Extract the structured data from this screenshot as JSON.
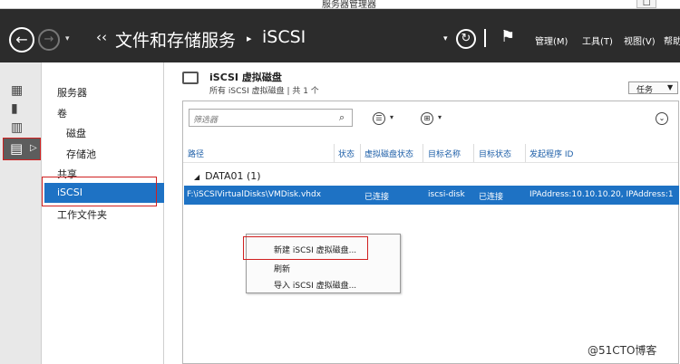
{
  "window": {
    "title": "服务器管理器",
    "controls": [
      "—",
      "□",
      "✕"
    ]
  },
  "header": {
    "back_glyph": "←",
    "forward_glyph": "→",
    "history_glyph": "▾",
    "crumb_glyph": "‹‹",
    "breadcrumb": [
      "文件和存储服务",
      "iSCSI"
    ],
    "separator": "▸",
    "dropdown_glyph": "▾",
    "refresh_glyph": "↻",
    "flag_glyph": "⚑",
    "menus": [
      "管理(M)",
      "工具(T)",
      "视图(V)",
      "帮助"
    ]
  },
  "rail": {
    "icons": [
      "dashboard-icon",
      "local-server-icon",
      "all-servers-icon",
      "file-storage-icon"
    ],
    "glyphs": [
      "▦",
      "▮",
      "▥",
      "▤"
    ],
    "expand_glyph": "▷"
  },
  "nav": {
    "items": [
      {
        "label": "服务器",
        "indent": false
      },
      {
        "label": "卷",
        "indent": false
      },
      {
        "label": "磁盘",
        "indent": true
      },
      {
        "label": "存储池",
        "indent": true
      },
      {
        "label": "共享",
        "indent": false
      },
      {
        "label": "iSCSI",
        "indent": false
      },
      {
        "label": "工作文件夹",
        "indent": false
      }
    ],
    "selected": "iSCSI"
  },
  "section": {
    "title": "iSCSI 虚拟磁盘",
    "subtitle": "所有 iSCSI 虚拟磁盘 | 共 1 个",
    "tasks_label": "任务",
    "tasks_glyph": "▼"
  },
  "toolbar": {
    "filter_placeholder": "筛选器",
    "search_glyph": "⌕",
    "list_glyph": "☰",
    "save_glyph": "⊞",
    "caret_glyph": "▾",
    "expand_glyph": "⌄"
  },
  "table": {
    "columns": [
      "路径",
      "状态",
      "虚拟磁盘状态",
      "目标名称",
      "目标状态",
      "发起程序 ID"
    ],
    "group_label": "DATA01 (1)",
    "group_glyph": "◢",
    "rows": [
      {
        "path": "F:\\iSCSIVirtualDisks\\VMDisk.vhdx",
        "status": "",
        "disk_status": "已连接",
        "target_name": "iscsi-disk",
        "target_status": "已连接",
        "initiator_id": "IPAddress:10.10.10.20, IPAddress:1"
      }
    ]
  },
  "context_menu": {
    "items": [
      "新建 iSCSI 虚拟磁盘...",
      "刷新",
      "导入 iSCSI 虚拟磁盘..."
    ]
  },
  "watermark": "@51CTO博客",
  "colors": {
    "header_bg": "#2c2c2c",
    "selection_blue": "#1e72c4",
    "highlight_red": "#d02020",
    "column_header_blue": "#1e5fa8"
  }
}
